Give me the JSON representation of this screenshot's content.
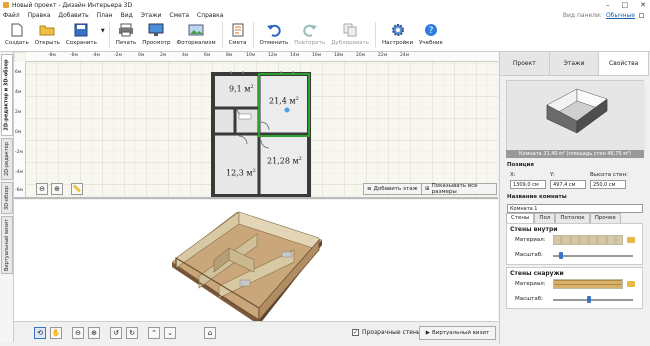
{
  "window": {
    "title": "Новый проект - Дизайн Интерьера 3D",
    "controls": [
      "–",
      "□",
      "✕"
    ]
  },
  "menu": {
    "items": [
      "Файл",
      "Правка",
      "Добавить",
      "План",
      "Вид",
      "Этажи",
      "Смета",
      "Справка"
    ],
    "view_label": "Вид панели:",
    "view_value": "Обычные"
  },
  "toolbar": [
    {
      "label": "Создать",
      "icon": "new-file-icon",
      "enabled": true
    },
    {
      "label": "Открыть",
      "icon": "folder-open-icon",
      "enabled": true
    },
    {
      "label": "Сохранить",
      "icon": "save-icon",
      "enabled": true
    },
    {
      "label": "Печать",
      "icon": "printer-icon",
      "enabled": true
    },
    {
      "label": "Просмотр",
      "icon": "monitor-icon",
      "enabled": true
    },
    {
      "label": "Фотореализм",
      "icon": "photo-icon",
      "enabled": true
    },
    {
      "label": "Смета",
      "icon": "estimate-icon",
      "enabled": true
    },
    {
      "label": "Отменить",
      "icon": "undo-icon",
      "enabled": true
    },
    {
      "label": "Повторить",
      "icon": "redo-icon",
      "enabled": false
    },
    {
      "label": "Дублировать",
      "icon": "duplicate-icon",
      "enabled": false
    },
    {
      "label": "Настройки",
      "icon": "gear-icon",
      "enabled": true
    },
    {
      "label": "Учебник",
      "icon": "help-icon",
      "enabled": true
    }
  ],
  "vertical_tabs": [
    "2D-редактор и 3D-обзор",
    "2D-редактор",
    "3D-обзор",
    "Виртуальный визит"
  ],
  "plan": {
    "ruler_labels": [
      "-8м",
      "-6м",
      "-4м",
      "-2м",
      "0м",
      "2м",
      "4м",
      "6м",
      "8м",
      "10м",
      "12м",
      "14м",
      "16м",
      "18м",
      "20м",
      "22м",
      "24м"
    ],
    "ruler_left_labels": [
      "6м",
      "4м",
      "2м",
      "0м",
      "-2м",
      "-4м",
      "-6м"
    ],
    "rooms": [
      {
        "label": "9,1 м",
        "sup": "2",
        "selected": false
      },
      {
        "label": "21,4 м",
        "sup": "2",
        "selected": true
      },
      {
        "label": "12,3 м",
        "sup": "2",
        "selected": false
      },
      {
        "label": "21,28 м",
        "sup": "2",
        "selected": false
      }
    ],
    "add_floor": "Добавить этаж",
    "show_sizes": "Показывать все размеры",
    "tools": [
      "zoom-out-icon",
      "zoom-in-icon",
      "ruler-icon"
    ]
  },
  "view3d": {
    "tools": [
      "rotate-icon",
      "hand-icon",
      "zoom-out-icon",
      "zoom-in-icon",
      "orbit-left-icon",
      "orbit-right-icon",
      "tilt-up-icon",
      "tilt-down-icon",
      "home-icon"
    ],
    "transparent_walls": "Прозрачные стены",
    "transparent_checked": true,
    "virtual_visit": "Виртуальный визит"
  },
  "panel": {
    "tabs": [
      "Проект",
      "Этажи",
      "Свойства"
    ],
    "active_tab": "Свойства",
    "caption": "Комната 21,40 м² (площадь стен 46,75 м²)",
    "position_label": "Позиция",
    "x_label": "X:",
    "x_value": "1309,0 см",
    "y_label": "Y:",
    "y_value": "497,4 см",
    "h_label": "Высота стен:",
    "h_value": "250,0 см",
    "name_label": "Название комнаты",
    "name_value": "Комната 1",
    "sub_tabs": [
      "Стены",
      "Пол",
      "Потолок",
      "Прочее"
    ],
    "walls_inside": "Стены внутри",
    "walls_outside": "Стены снаружи",
    "material_label": "Материал:",
    "scale_label": "Масштаб:",
    "inside_scale": 0.1,
    "outside_scale": 0.45
  },
  "colors": {
    "selected_room": "#2ea02e",
    "wall": "#3a3a3a",
    "floor": "#c9a77a",
    "wall_inner": "#d6c8a4",
    "brick": "#d9b06a"
  }
}
